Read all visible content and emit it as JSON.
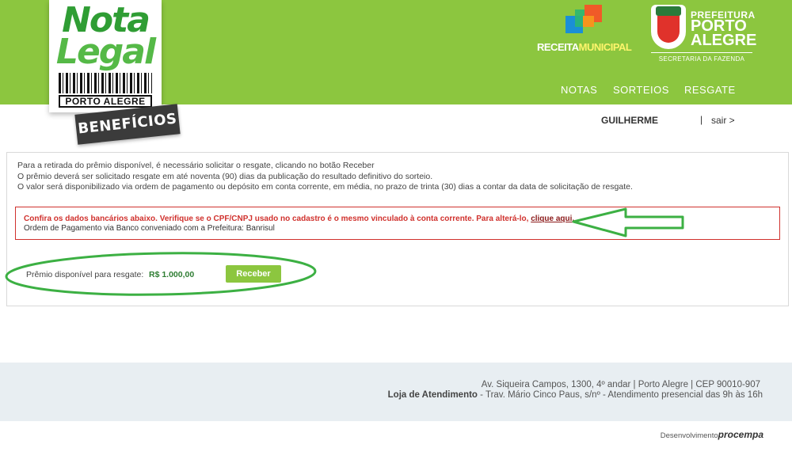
{
  "header": {
    "logo": {
      "line1": "Nota",
      "line2": "Legal",
      "city": "PORTO ALEGRE"
    },
    "tag": "BENEFÍCIOS",
    "receita": {
      "part1": "RECEITA",
      "part2": "MUNICIPAL"
    },
    "prefeitura": {
      "line1": "PREFEITURA",
      "line2": "PORTO",
      "line3": "ALEGRE",
      "sub": "SECRETARIA DA FAZENDA"
    },
    "nav": [
      "NOTAS",
      "SORTEIOS",
      "RESGATE"
    ],
    "user_name": "GUILHERME",
    "separator": "|",
    "logout": "sair >"
  },
  "main": {
    "info_lines": [
      "Para a retirada do prêmio disponível, é necessário solicitar o resgate, clicando no botão Receber",
      "O prêmio deverá ser solicitado resgate em até noventa (90) dias da publicação do resultado definitivo do sorteio.",
      "O valor será disponibilizado via ordem de pagamento ou depósito em conta corrente, em média, no prazo de trinta (30) dias a contar da data de solicitação de resgate."
    ],
    "alert": {
      "message": "Confira os dados bancários abaixo. Verifique se o CPF/CNPJ usado no cadastro é o mesmo vinculado à conta corrente. Para alterá-lo, ",
      "link": "clique aqui.",
      "sub": "Ordem de Pagamento via Banco conveniado com a Prefeitura: Banrisul"
    },
    "prize": {
      "label": "Prêmio disponível para resgate:",
      "value": "R$ 1.000,00",
      "button": "Receber"
    }
  },
  "footer": {
    "address": "Av. Siqueira Campos, 1300, 4º andar | Porto Alegre | CEP 90010-907",
    "store_label": "Loja de Atendimento",
    "store_text": " - Trav. Mário Cinco Paus, s/nº - Atendimento presencial das 9h às 16h",
    "credit_prefix": "Desenvolvimento",
    "credit_brand": "procempa"
  },
  "colors": {
    "brand_green": "#8cc63f",
    "alert_red": "#d0312d",
    "annotation_green": "#3cb043"
  }
}
